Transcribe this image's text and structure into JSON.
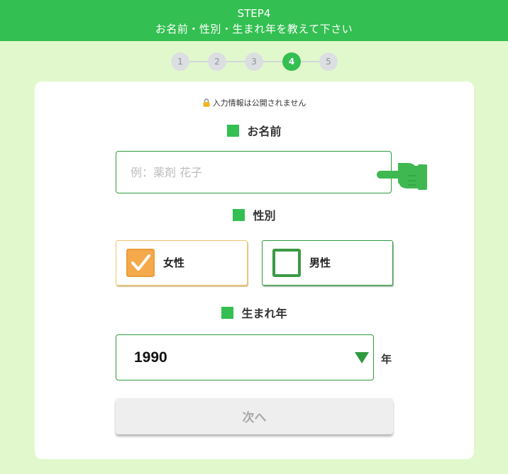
{
  "header": {
    "step": "STEP4",
    "title": "お名前・性別・生まれ年を教えて下さい"
  },
  "stepper": {
    "steps": [
      "1",
      "2",
      "3",
      "4",
      "5"
    ],
    "current": 4
  },
  "privacy_note": "入力情報は公開されません",
  "name_section": {
    "label": "お名前",
    "placeholder": "例：薬剤 花子",
    "value": ""
  },
  "gender_section": {
    "label": "性別",
    "options": [
      {
        "label": "女性",
        "checked": true
      },
      {
        "label": "男性",
        "checked": false
      }
    ]
  },
  "birth_year_section": {
    "label": "生まれ年",
    "selected": "1990",
    "unit": "年"
  },
  "next_button": {
    "label": "次へ",
    "disabled": true
  },
  "colors": {
    "brand_green": "#33bf51",
    "page_background": "#e1f8cc",
    "female_checked": "#f5a94a",
    "male_border": "#3a9a45"
  },
  "icons": [
    "lock-icon",
    "pointing-hand-icon",
    "checkmark-icon",
    "dropdown-triangle-icon"
  ]
}
